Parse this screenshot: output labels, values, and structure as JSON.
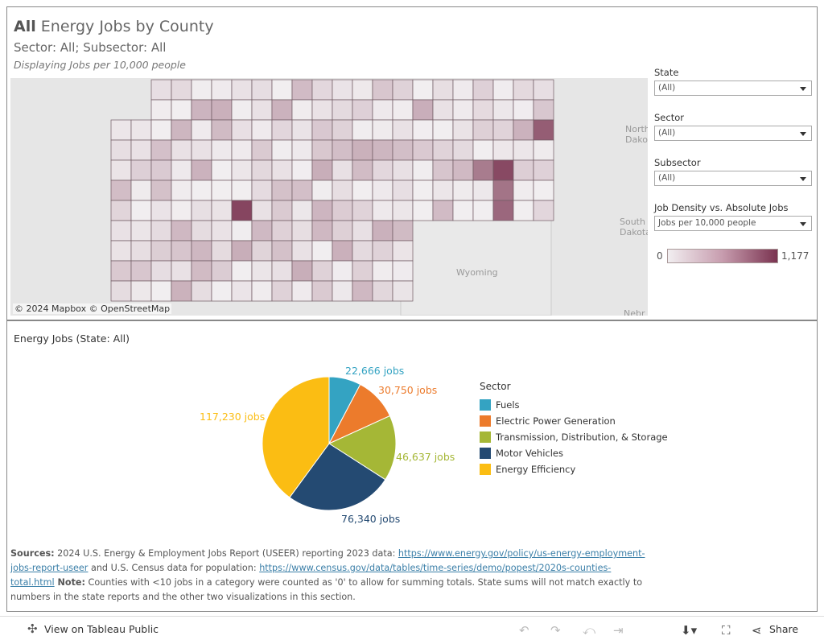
{
  "header": {
    "title_bold": "All",
    "title_rest": " Energy Jobs by County",
    "subtitle": "Sector: All; Subsector: All",
    "note": "Displaying Jobs per 10,000 people"
  },
  "map": {
    "attribution": "© 2024 Mapbox  © OpenStreetMap",
    "labels": [
      "North Dakota",
      "South Dakota",
      "Wyoming",
      "Nebr"
    ],
    "color_low": "#f1eef0",
    "color_high": "#7a3350"
  },
  "filters": [
    {
      "label": "State",
      "value": "(All)"
    },
    {
      "label": "Sector",
      "value": "(All)"
    },
    {
      "label": "Subsector",
      "value": "(All)"
    },
    {
      "label": "Job Density vs. Absolute Jobs",
      "value": "Jobs per 10,000 people"
    }
  ],
  "color_legend": {
    "min": "0",
    "max": "1,177"
  },
  "pie": {
    "title": "Energy Jobs (State: All)",
    "legend_title": "Sector"
  },
  "chart_data": {
    "type": "pie",
    "title": "Energy Jobs (State: All)",
    "legend_title": "Sector",
    "legend_position": "right",
    "series": [
      {
        "name": "Fuels",
        "value": 22666,
        "label": "22,666 jobs",
        "color": "#34a3c2"
      },
      {
        "name": "Electric Power Generation",
        "value": 30750,
        "label": "30,750 jobs",
        "color": "#ec7b2c"
      },
      {
        "name": "Transmission, Distribution, & Storage",
        "value": 46637,
        "label": "46,637 jobs",
        "color": "#a5b736"
      },
      {
        "name": "Motor Vehicles",
        "value": 76340,
        "label": "76,340 jobs",
        "color": "#244a72"
      },
      {
        "name": "Energy Efficiency",
        "value": 117230,
        "label": "117,230 jobs",
        "color": "#fbbd13"
      }
    ]
  },
  "sources": {
    "label": "Sources:",
    "t1": " 2024 U.S. Energy & Employment Jobs Report (USEER) reporting 2023 data: ",
    "link1": "https://www.energy.gov/policy/us-energy-employment-jobs-report-useer",
    "t2": " and U.S. Census data for population: ",
    "link2": "https://www.census.gov/data/tables/time-series/demo/popest/2020s-counties-total.html",
    "note_label": " Note:",
    "t3": " Counties with <10 jobs in a category were counted as '0' to allow for summing totals. State sums will not match exactly to numbers in the state reports and the other two visualizations in this section."
  },
  "toolbar": {
    "view": "View on Tableau Public",
    "share": "Share"
  }
}
